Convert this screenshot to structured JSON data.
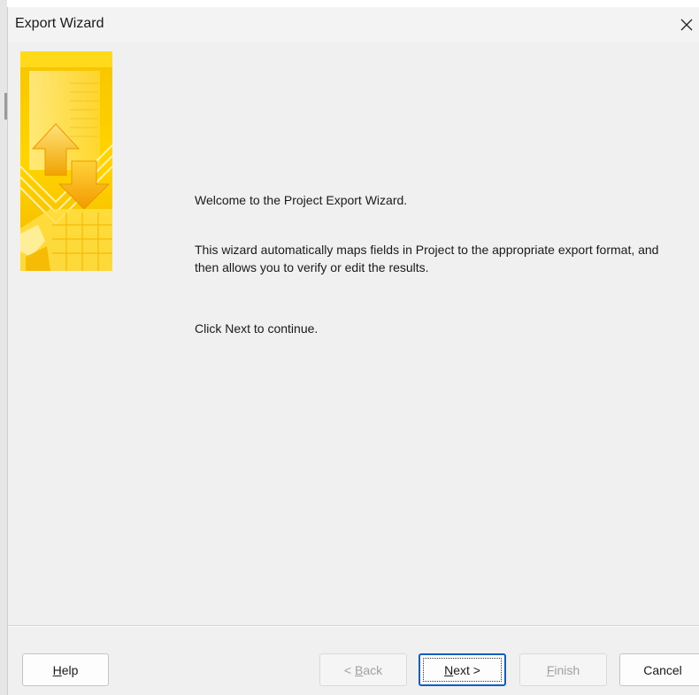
{
  "window": {
    "title": "Export Wizard",
    "close_glyph": "✕"
  },
  "banner": {
    "icon": "export-wizard-banner-art",
    "colors": {
      "gold": "#f7c600",
      "light": "#ffe566",
      "orange": "#f5a300"
    }
  },
  "content": {
    "welcome": "Welcome to the Project Export Wizard.",
    "description_line1": "This wizard automatically maps fields in Project to the appropriate export format, and",
    "description_line2": "then allows you to verify or edit the results.",
    "instruction": "Click Next to continue."
  },
  "buttons": {
    "help": {
      "mnemonic": "H",
      "rest": "elp"
    },
    "back": {
      "prefix": "< ",
      "mnemonic": "B",
      "rest": "ack",
      "enabled": false
    },
    "next": {
      "mnemonic": "N",
      "rest": "ext >",
      "enabled": true
    },
    "finish": {
      "mnemonic": "F",
      "rest": "inish",
      "enabled": false
    },
    "cancel": {
      "label": "Cancel"
    }
  }
}
